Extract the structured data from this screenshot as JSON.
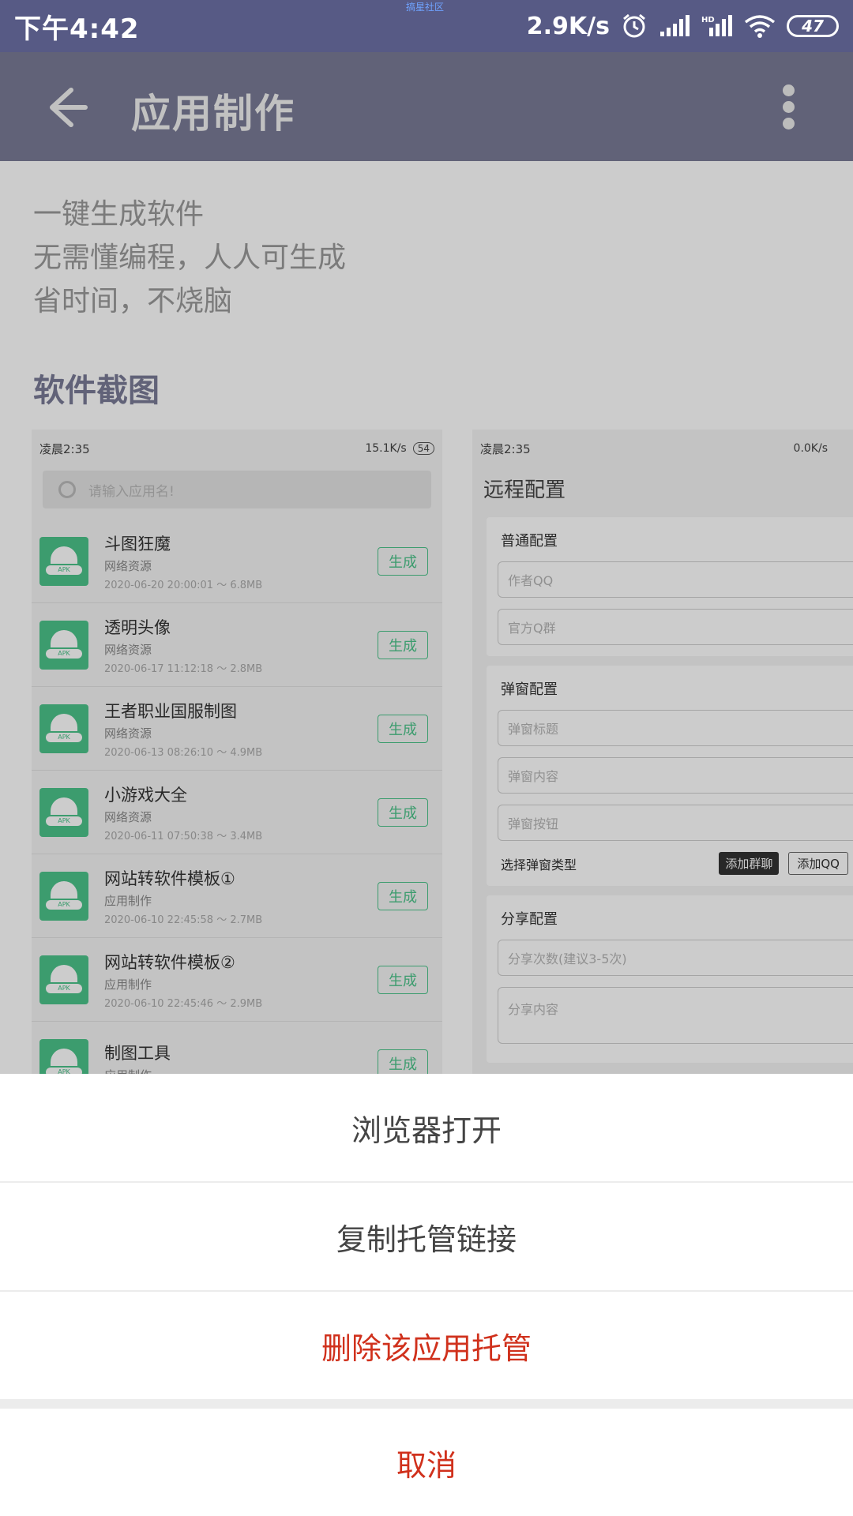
{
  "status_bar": {
    "time": "下午4:42",
    "carrier_text": "搞星社区",
    "network_speed": "2.9K/s",
    "battery": "47"
  },
  "app_bar": {
    "title": "应用制作",
    "back_icon": "arrow-left-icon",
    "more_icon": "more-vertical-icon"
  },
  "intro": {
    "lines": [
      "一键生成软件",
      "无需懂编程，人人可生成",
      "省时间，不烧脑"
    ]
  },
  "screenshots_section": {
    "title": "软件截图",
    "left": {
      "time": "凌晨2:35",
      "status_right": "15.1K/s",
      "battery": "54",
      "search_placeholder": "请输入应用名!",
      "apps": [
        {
          "name": "斗图狂魔",
          "category": "网络资源",
          "meta": "2020-06-20 20:00:01 ～ 6.8MB",
          "button": "生成"
        },
        {
          "name": "透明头像",
          "category": "网络资源",
          "meta": "2020-06-17 11:12:18 ～ 2.8MB",
          "button": "生成"
        },
        {
          "name": "王者职业国服制图",
          "category": "网络资源",
          "meta": "2020-06-13 08:26:10 ～ 4.9MB",
          "button": "生成"
        },
        {
          "name": "小游戏大全",
          "category": "网络资源",
          "meta": "2020-06-11 07:50:38 ～ 3.4MB",
          "button": "生成"
        },
        {
          "name": "网站转软件模板①",
          "category": "应用制作",
          "meta": "2020-06-10 22:45:58 ～ 2.7MB",
          "button": "生成"
        },
        {
          "name": "网站转软件模板②",
          "category": "应用制作",
          "meta": "2020-06-10 22:45:46 ～ 2.9MB",
          "button": "生成"
        },
        {
          "name": "制图工具",
          "category": "应用制作",
          "meta": "",
          "button": "生成"
        }
      ]
    },
    "right": {
      "time": "凌晨2:35",
      "status_right": "0.0K/s",
      "title": "远程配置",
      "cards": {
        "normal": {
          "title": "普通配置",
          "fields": [
            "作者QQ",
            "官方Q群"
          ]
        },
        "popup": {
          "title": "弹窗配置",
          "fields": [
            "弹窗标题",
            "弹窗内容",
            "弹窗按钮"
          ],
          "type_label": "选择弹窗类型",
          "chip_group": "添加群聊",
          "chip_qq": "添加QQ"
        },
        "share": {
          "title": "分享配置",
          "fields": [
            "分享次数(建议3-5次)",
            "分享内容"
          ]
        }
      }
    }
  },
  "sheet": {
    "items": [
      {
        "label": "浏览器打开",
        "color": "#444444"
      },
      {
        "label": "复制托管链接",
        "color": "#444444"
      },
      {
        "label": "删除该应用托管",
        "color": "#d0311c"
      }
    ],
    "cancel": "取消"
  }
}
